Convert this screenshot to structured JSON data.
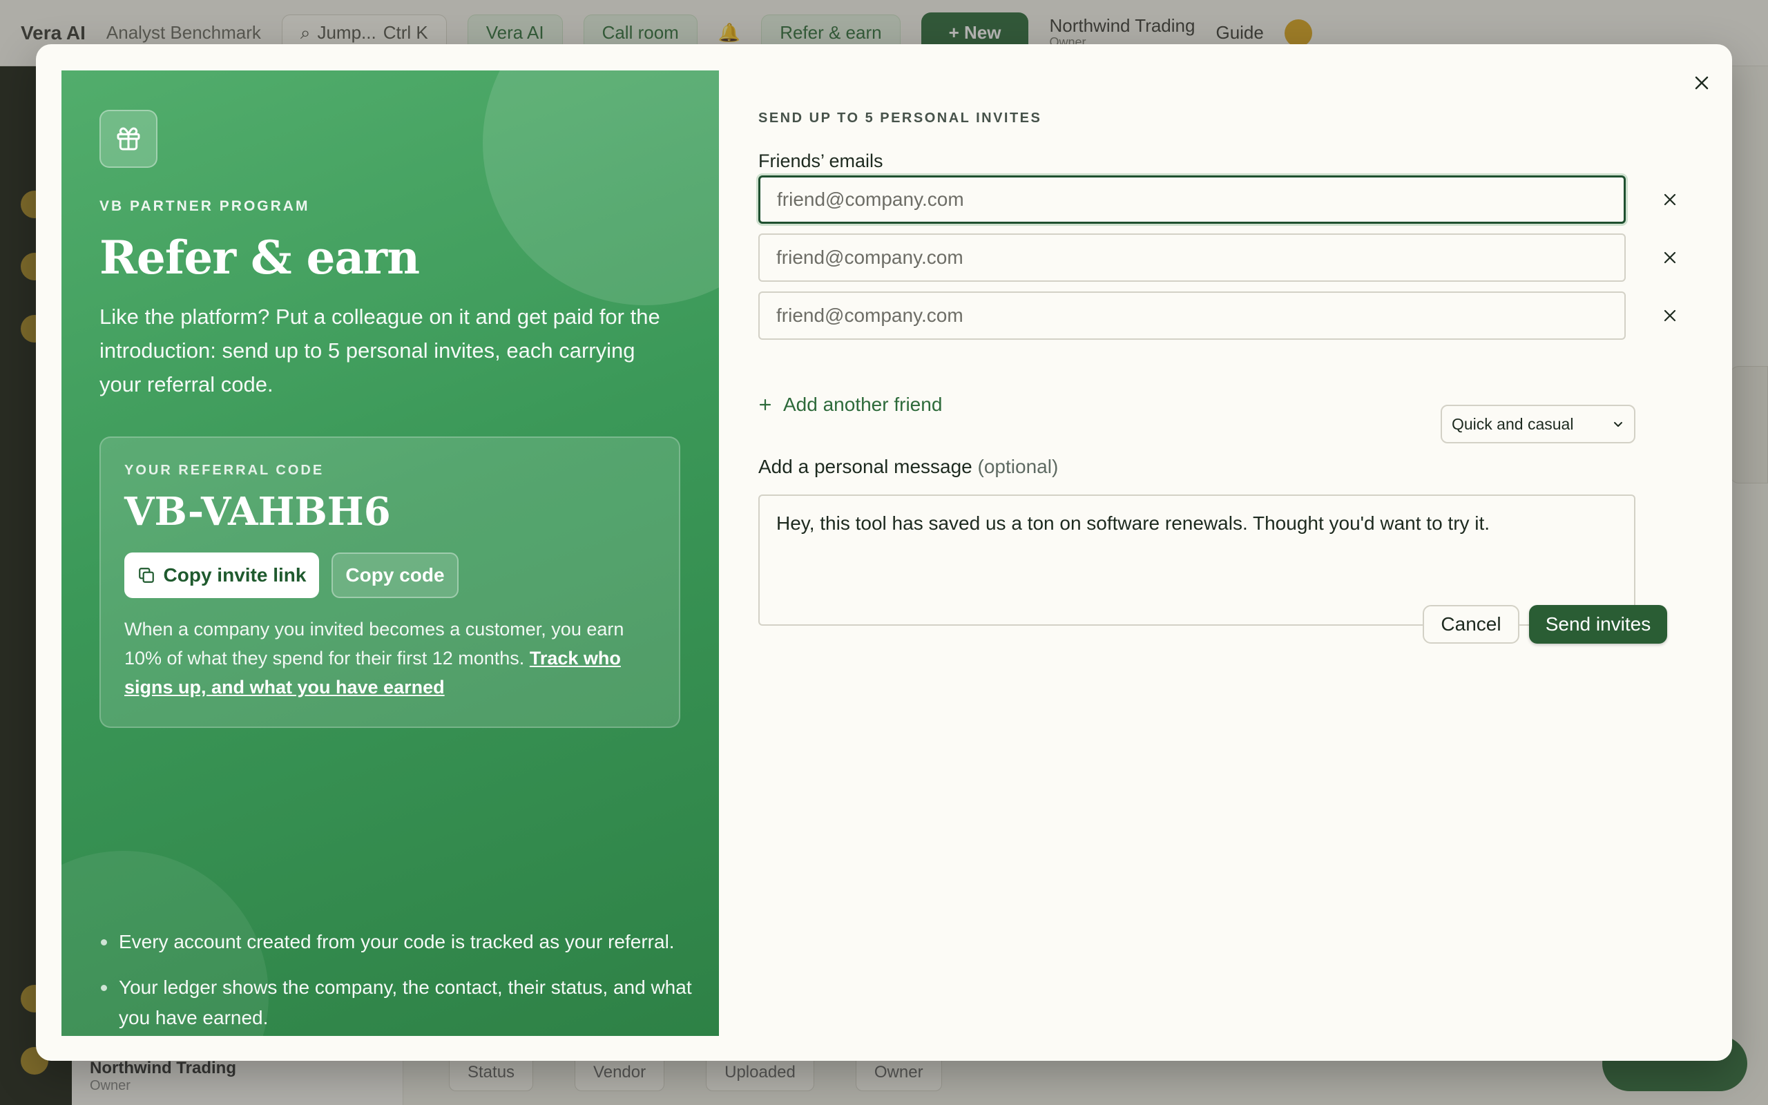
{
  "background": {
    "brand": "Vera AI",
    "breadcrumb": "Analyst Benchmark",
    "search_placeholder": "Jump...",
    "search_shortcut": "Ctrl K",
    "pill_vera": "Vera AI",
    "pill_call": "Call room",
    "pill_refer": "Refer & earn",
    "new_button": "+ New",
    "org_name": "Northwind Trading",
    "org_sub": "Owner",
    "guide": "Guide",
    "sidebar_org": "Northwind Trading",
    "sidebar_org_sub": "Owner",
    "filters": [
      "Status",
      "Vendor",
      "Uploaded",
      "Owner"
    ]
  },
  "modal": {
    "close_label": "Close",
    "hero": {
      "eyebrow": "VB PARTNER PROGRAM",
      "title": "Refer & earn",
      "description": "Like the platform? Put a colleague on it and get paid for the introduction: send up to 5 personal invites, each carrying your referral code.",
      "code_card": {
        "label": "YOUR REFERRAL CODE",
        "code": "VB-VAHBH6",
        "copy_link": "Copy invite link",
        "copy_code": "Copy code",
        "note": "When a company you invited becomes a customer, you earn 10% of what they spend for their first 12 months.",
        "note_link": "Track who signs up, and what you have earned"
      },
      "bullets": [
        "Every account created from your code is tracked as your referral.",
        "Your ledger shows the company, the contact, their status, and what you have earned."
      ]
    },
    "form": {
      "eyebrow": "SEND UP TO 5 PERSONAL INVITES",
      "emails_label": "Friends’ emails",
      "email_placeholder": "friend@company.com",
      "emails": [
        "",
        "",
        ""
      ],
      "add_friend": "Add another friend",
      "message_label": "Add a personal message",
      "message_optional": "(optional)",
      "tone_selected": "Quick and casual",
      "message": "Hey, this tool has saved us a ton on software renewals. Thought you'd want to try it.",
      "cancel": "Cancel",
      "send": "Send invites"
    }
  },
  "colors": {
    "accent_dark": "#2a5d34",
    "hero_green": "#3b9858",
    "link_green": "#2d6a3a"
  }
}
